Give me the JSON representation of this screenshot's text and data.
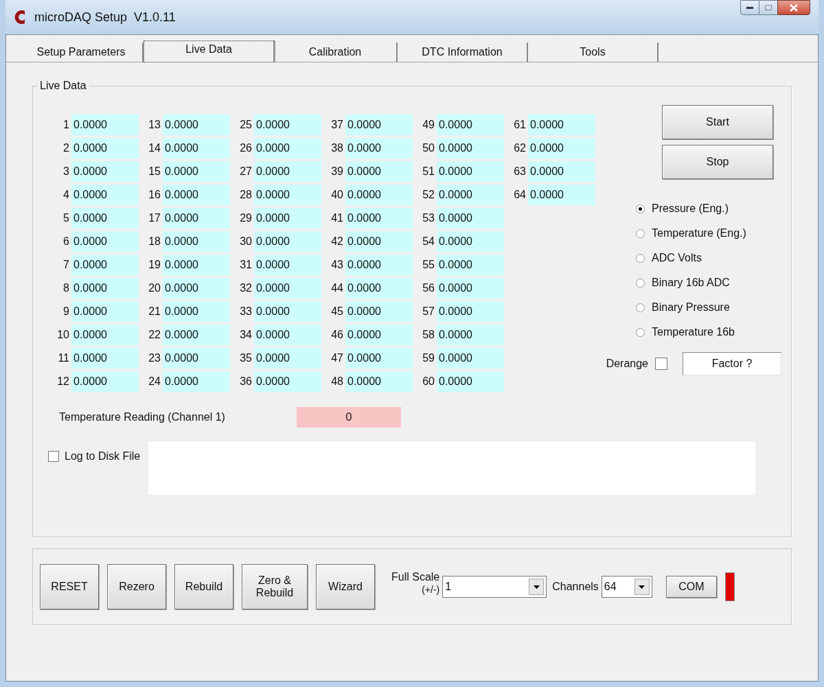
{
  "window": {
    "title": "microDAQ Setup  V1.0.11"
  },
  "tabs": [
    {
      "label": "Setup Parameters",
      "selected": false
    },
    {
      "label": "Live Data",
      "selected": true
    },
    {
      "label": "Calibration",
      "selected": false
    },
    {
      "label": "DTC Information",
      "selected": false
    },
    {
      "label": "Tools",
      "selected": false
    }
  ],
  "live_data": {
    "title": "Live Data",
    "channels": [
      {
        "number": "1",
        "value": "0.0000"
      },
      {
        "number": "2",
        "value": "0.0000"
      },
      {
        "number": "3",
        "value": "0.0000"
      },
      {
        "number": "4",
        "value": "0.0000"
      },
      {
        "number": "5",
        "value": "0.0000"
      },
      {
        "number": "6",
        "value": "0.0000"
      },
      {
        "number": "7",
        "value": "0.0000"
      },
      {
        "number": "8",
        "value": "0.0000"
      },
      {
        "number": "9",
        "value": "0.0000"
      },
      {
        "number": "10",
        "value": "0.0000"
      },
      {
        "number": "11",
        "value": "0.0000"
      },
      {
        "number": "12",
        "value": "0.0000"
      },
      {
        "number": "13",
        "value": "0.0000"
      },
      {
        "number": "14",
        "value": "0.0000"
      },
      {
        "number": "15",
        "value": "0.0000"
      },
      {
        "number": "16",
        "value": "0.0000"
      },
      {
        "number": "17",
        "value": "0.0000"
      },
      {
        "number": "18",
        "value": "0.0000"
      },
      {
        "number": "19",
        "value": "0.0000"
      },
      {
        "number": "20",
        "value": "0.0000"
      },
      {
        "number": "21",
        "value": "0.0000"
      },
      {
        "number": "22",
        "value": "0.0000"
      },
      {
        "number": "23",
        "value": "0.0000"
      },
      {
        "number": "24",
        "value": "0.0000"
      },
      {
        "number": "25",
        "value": "0.0000"
      },
      {
        "number": "26",
        "value": "0.0000"
      },
      {
        "number": "27",
        "value": "0.0000"
      },
      {
        "number": "28",
        "value": "0.0000"
      },
      {
        "number": "29",
        "value": "0.0000"
      },
      {
        "number": "30",
        "value": "0.0000"
      },
      {
        "number": "31",
        "value": "0.0000"
      },
      {
        "number": "32",
        "value": "0.0000"
      },
      {
        "number": "33",
        "value": "0.0000"
      },
      {
        "number": "34",
        "value": "0.0000"
      },
      {
        "number": "35",
        "value": "0.0000"
      },
      {
        "number": "36",
        "value": "0.0000"
      },
      {
        "number": "37",
        "value": "0.0000"
      },
      {
        "number": "38",
        "value": "0.0000"
      },
      {
        "number": "39",
        "value": "0.0000"
      },
      {
        "number": "40",
        "value": "0.0000"
      },
      {
        "number": "41",
        "value": "0.0000"
      },
      {
        "number": "42",
        "value": "0.0000"
      },
      {
        "number": "43",
        "value": "0.0000"
      },
      {
        "number": "44",
        "value": "0.0000"
      },
      {
        "number": "45",
        "value": "0.0000"
      },
      {
        "number": "46",
        "value": "0.0000"
      },
      {
        "number": "47",
        "value": "0.0000"
      },
      {
        "number": "48",
        "value": "0.0000"
      },
      {
        "number": "49",
        "value": "0.0000"
      },
      {
        "number": "50",
        "value": "0.0000"
      },
      {
        "number": "51",
        "value": "0.0000"
      },
      {
        "number": "52",
        "value": "0.0000"
      },
      {
        "number": "53",
        "value": "0.0000"
      },
      {
        "number": "54",
        "value": "0.0000"
      },
      {
        "number": "55",
        "value": "0.0000"
      },
      {
        "number": "56",
        "value": "0.0000"
      },
      {
        "number": "57",
        "value": "0.0000"
      },
      {
        "number": "58",
        "value": "0.0000"
      },
      {
        "number": "59",
        "value": "0.0000"
      },
      {
        "number": "60",
        "value": "0.0000"
      },
      {
        "number": "61",
        "value": "0.0000"
      },
      {
        "number": "62",
        "value": "0.0000"
      },
      {
        "number": "63",
        "value": "0.0000"
      },
      {
        "number": "64",
        "value": "0.0000"
      }
    ],
    "start_button": "Start",
    "stop_button": "Stop",
    "display_modes": [
      {
        "label": "Pressure (Eng.)",
        "selected": true
      },
      {
        "label": "Temperature (Eng.)",
        "selected": false
      },
      {
        "label": "ADC Volts",
        "selected": false
      },
      {
        "label": "Binary 16b ADC",
        "selected": false
      },
      {
        "label": "Binary Pressure",
        "selected": false
      },
      {
        "label": "Temperature 16b",
        "selected": false
      }
    ],
    "derange": {
      "label": "Derange",
      "checked": false
    },
    "factor_button": "Factor ?",
    "temperature": {
      "label": "Temperature Reading (Channel 1)",
      "value": "0"
    },
    "log_to_disk": {
      "label": "Log to Disk File",
      "checked": false
    }
  },
  "toolbar": {
    "buttons": [
      "RESET",
      "Rezero",
      "Rebuild",
      "Zero & Rebuild",
      "Wizard"
    ],
    "full_scale": {
      "label": "Full Scale",
      "sublabel": "(+/-)",
      "value": "1"
    },
    "channels": {
      "label": "Channels",
      "value": "64"
    },
    "com_button": "COM",
    "connected": false
  }
}
